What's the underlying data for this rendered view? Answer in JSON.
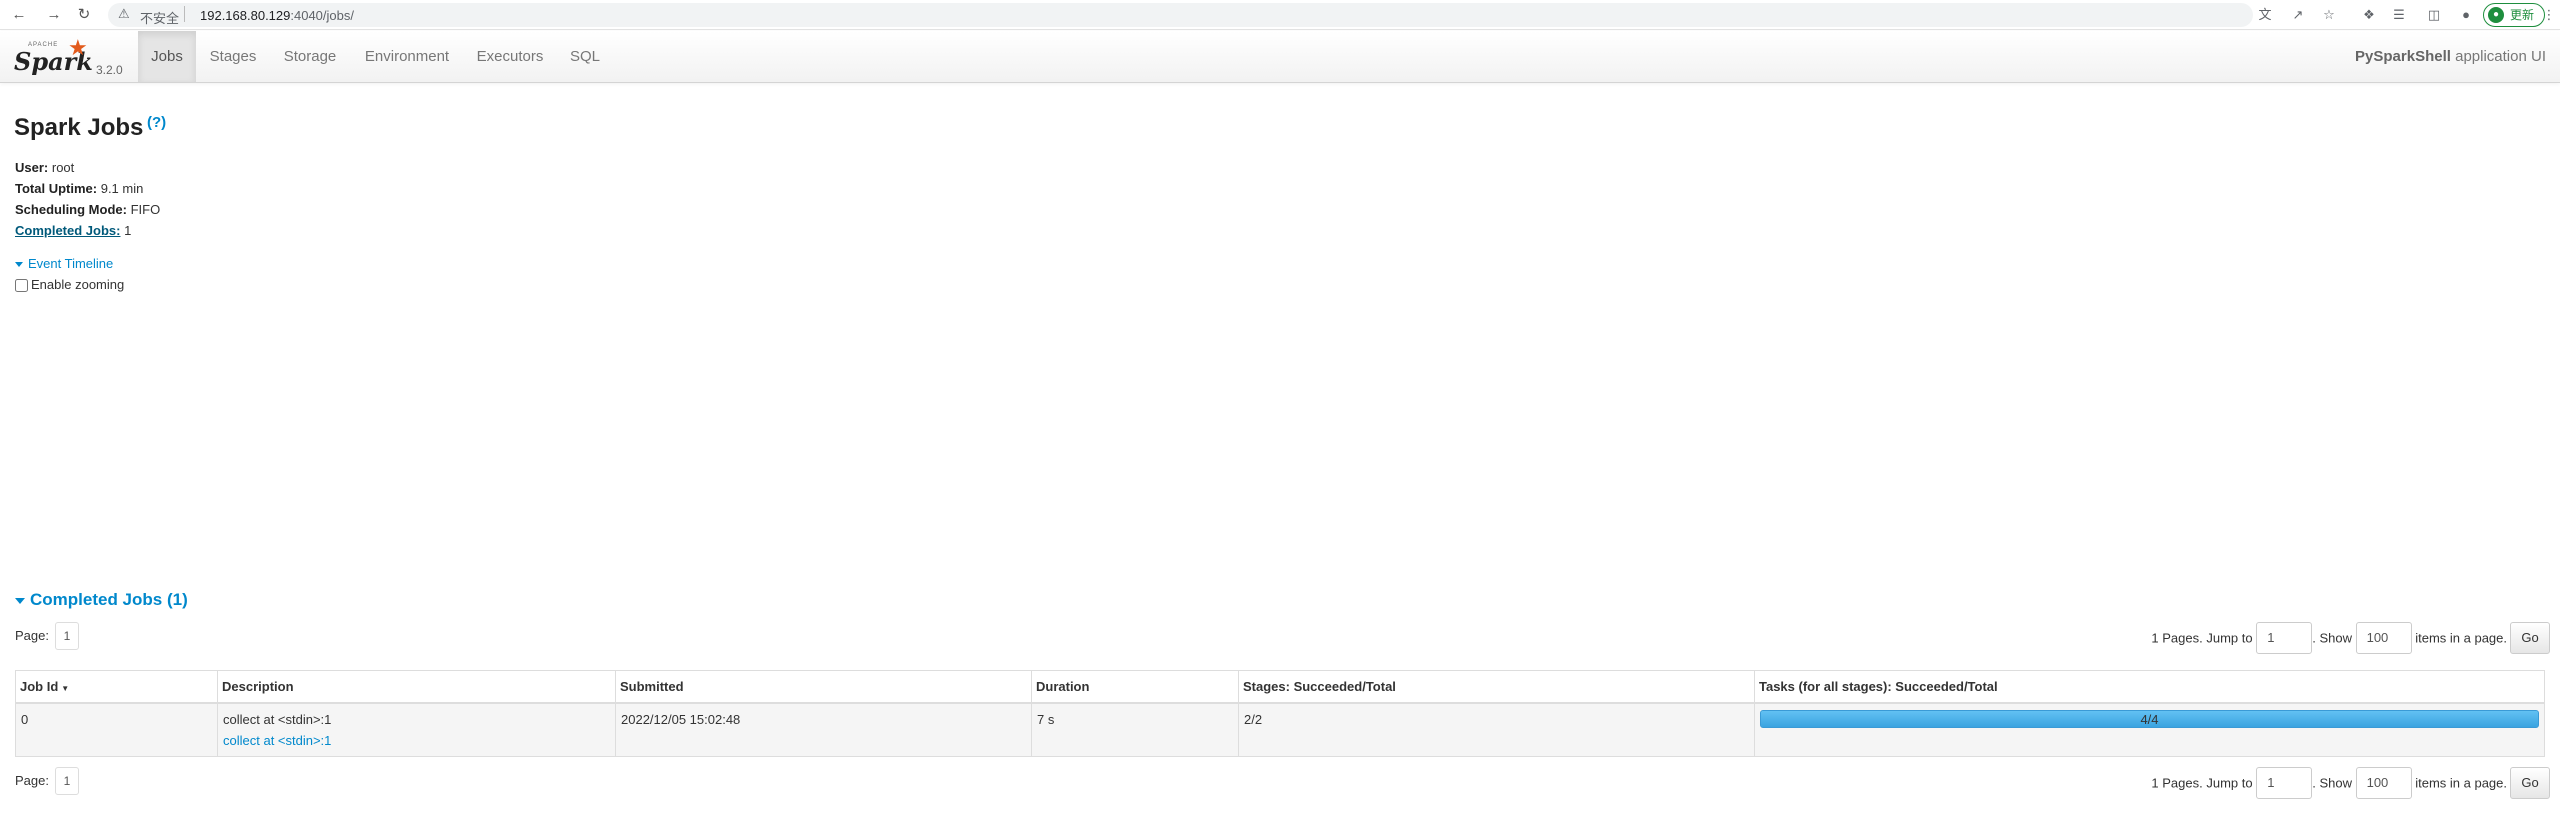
{
  "browser": {
    "security_label": "不安全",
    "url_host": "192.168.80.129",
    "url_rest": ":4040/jobs/",
    "update_label": "更新"
  },
  "navbar": {
    "brand_word": "Spark",
    "brand_small": "APACHE",
    "version": "3.2.0",
    "tabs": [
      "Jobs",
      "Stages",
      "Storage",
      "Environment",
      "Executors",
      "SQL"
    ],
    "active_tab": "Jobs",
    "app_name": "PySparkShell",
    "app_suffix": " application UI"
  },
  "page": {
    "title": "Spark Jobs",
    "help": "(?)",
    "user_label": "User:",
    "user": "root",
    "uptime_label": "Total Uptime:",
    "uptime": "9.1 min",
    "scheduling_label": "Scheduling Mode:",
    "scheduling": "FIFO",
    "completed_label": "Completed Jobs:",
    "completed_count": "1",
    "timeline_label": "Event Timeline",
    "zoom_label": "Enable zooming"
  },
  "completed_section": {
    "title": "Completed Jobs (1)",
    "page_label": "Page:",
    "current_page": "1",
    "pages_text": "1 Pages. Jump to",
    "jump_value": "1",
    "show_label": ". Show",
    "show_value": "100",
    "items_label": "items in a page.",
    "go_label": "Go",
    "columns": [
      "Job Id",
      "Description",
      "Submitted",
      "Duration",
      "Stages: Succeeded/Total",
      "Tasks (for all stages): Succeeded/Total"
    ],
    "rows": [
      {
        "job_id": "0",
        "description": "collect at <stdin>:1",
        "description_link": "collect at <stdin>:1",
        "submitted": "2022/12/05 15:02:48",
        "duration": "7 s",
        "stages": "2/2",
        "tasks_text": "4/4",
        "tasks_progress": 1.0
      }
    ]
  },
  "colors": {
    "accent": "#0088cc",
    "progress": "#4db2e9",
    "spark_orange": "#e25a1c"
  }
}
